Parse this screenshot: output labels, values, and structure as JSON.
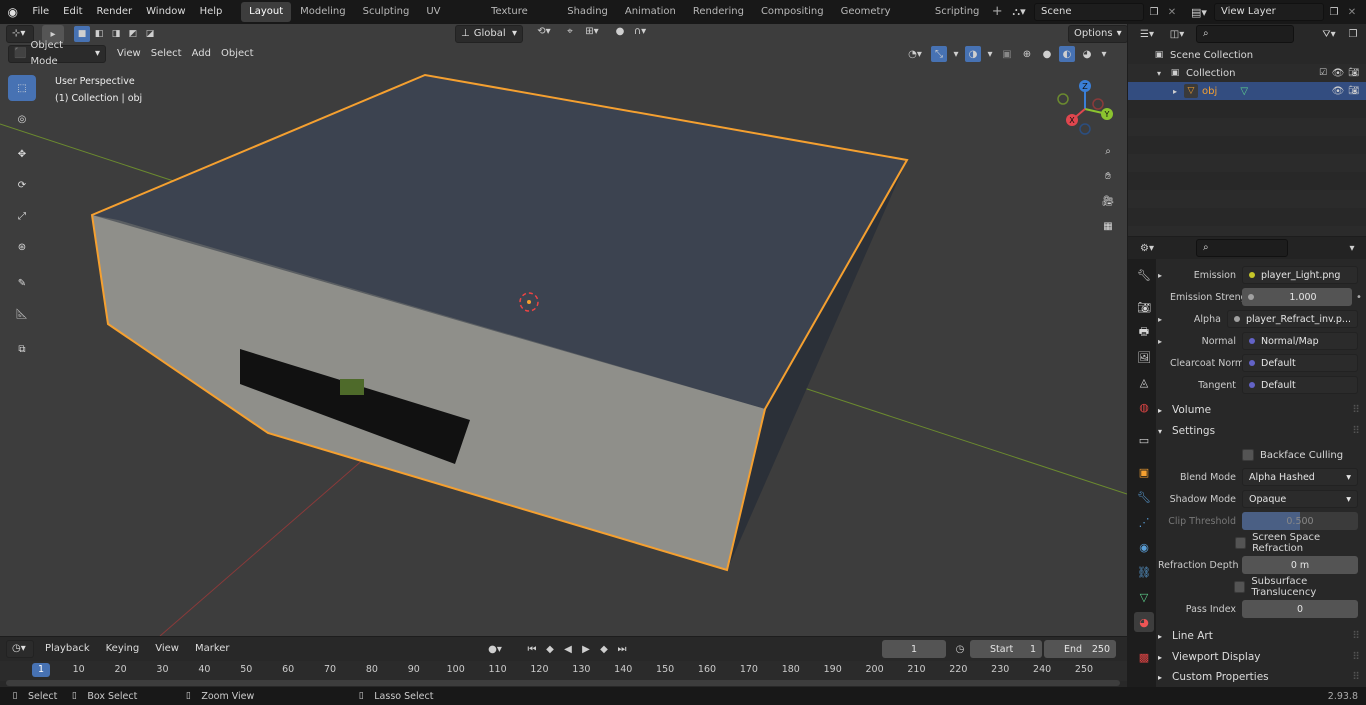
{
  "topbar": {
    "menus": [
      "File",
      "Edit",
      "Render",
      "Window",
      "Help"
    ],
    "workspaces": [
      "Layout",
      "Modeling",
      "Sculpting",
      "UV Editing",
      "Texture Paint",
      "Shading",
      "Animation",
      "Rendering",
      "Compositing",
      "Geometry Nodes",
      "Scripting"
    ],
    "active_workspace": "Layout",
    "scene": "Scene",
    "view_layer": "View Layer"
  },
  "viewport": {
    "mode": "Object Mode",
    "menus": [
      "View",
      "Select",
      "Add",
      "Object"
    ],
    "transform_orientation": "Global",
    "options_label": "Options",
    "overlay_title": "User Perspective",
    "overlay_subtitle": "(1) Collection | obj",
    "tools": [
      "select-box",
      "cursor",
      "move",
      "rotate",
      "scale",
      "transform",
      "annotate",
      "measure",
      "add-cube"
    ],
    "gizmo_axes": [
      "X",
      "Y",
      "Z"
    ],
    "accent_color": "#4772b3",
    "selection_outline": "#f5a030"
  },
  "outliner": {
    "search_placeholder": "",
    "items": [
      {
        "label": "Scene Collection",
        "depth": 0
      },
      {
        "label": "Collection",
        "depth": 1
      },
      {
        "label": "obj",
        "depth": 2,
        "selected": true
      }
    ]
  },
  "properties": {
    "rows": [
      {
        "label": "Emission",
        "value": "player_Light.png",
        "expander": true,
        "socket": "yellow"
      },
      {
        "label": "Emission Strengt",
        "value": "1.000",
        "socket": "grey",
        "numeric": true
      },
      {
        "label": "Alpha",
        "value": "player_Refract_inv.p...",
        "expander": true,
        "socket": "grey"
      },
      {
        "label": "Normal",
        "value": "Normal/Map",
        "expander": true,
        "socket": "purple"
      },
      {
        "label": "Clearcoat Normal",
        "value": "Default",
        "socket": "purple"
      },
      {
        "label": "Tangent",
        "value": "Default",
        "socket": "purple"
      }
    ],
    "sections": {
      "volume": "Volume",
      "settings": "Settings",
      "line_art": "Line Art",
      "viewport_display": "Viewport Display",
      "custom_properties": "Custom Properties"
    },
    "settings": {
      "backface_culling": "Backface Culling",
      "blend_mode_label": "Blend Mode",
      "blend_mode": "Alpha Hashed",
      "shadow_mode_label": "Shadow Mode",
      "shadow_mode": "Opaque",
      "clip_threshold_label": "Clip Threshold",
      "clip_threshold": "0.500",
      "clip_threshold_fraction": 0.5,
      "screen_space_refraction": "Screen Space Refraction",
      "refraction_depth_label": "Refraction Depth",
      "refraction_depth": "0 m",
      "subsurface_translucency": "Subsurface Translucency",
      "pass_index_label": "Pass Index",
      "pass_index": "0"
    }
  },
  "timeline": {
    "menus": [
      "Playback",
      "Keying",
      "View",
      "Marker"
    ],
    "current_frame": "1",
    "start_label": "Start",
    "start": "1",
    "end_label": "End",
    "end": "250",
    "ticks": [
      "10",
      "20",
      "30",
      "40",
      "50",
      "60",
      "70",
      "80",
      "90",
      "100",
      "110",
      "120",
      "130",
      "140",
      "150",
      "160",
      "170",
      "180",
      "190",
      "200",
      "210",
      "220",
      "230",
      "240",
      "250"
    ],
    "playhead": "1"
  },
  "statusbar": {
    "select": "Select",
    "box_select": "Box Select",
    "zoom_view": "Zoom View",
    "lasso_select": "Lasso Select",
    "version": "2.93.8"
  }
}
